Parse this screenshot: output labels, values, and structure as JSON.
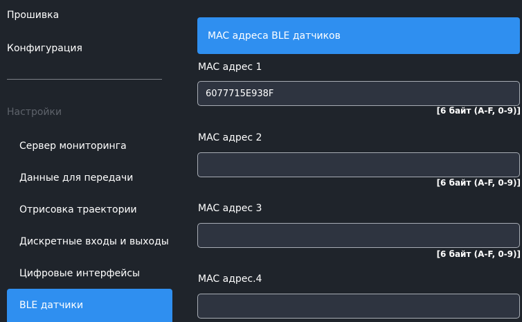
{
  "sidebar": {
    "top_links": [
      "Прошивка",
      "Конфигурация"
    ],
    "section_label": "Настройки",
    "items": [
      {
        "label": "Сервер мониторинга",
        "active": false
      },
      {
        "label": "Данные для передачи",
        "active": false
      },
      {
        "label": "Отрисовка траектории",
        "active": false
      },
      {
        "label": "Дискретные входы и выходы",
        "active": false
      },
      {
        "label": "Цифровые интерфейсы",
        "active": false
      },
      {
        "label": "BLE датчики",
        "active": true
      }
    ]
  },
  "main": {
    "banner_title": "MAC адреса BLE датчиков",
    "fields": [
      {
        "label": "MAC адрес 1",
        "value": "6077715E938F",
        "hint": "[6 байт (A-F, 0-9)]"
      },
      {
        "label": "MAC адрес 2",
        "value": "",
        "hint": "[6 байт (A-F, 0-9)]"
      },
      {
        "label": "MAC адрес 3",
        "value": "",
        "hint": "[6 байт (A-F, 0-9)]"
      },
      {
        "label": "MAC адрес.4",
        "value": "",
        "hint": ""
      }
    ]
  },
  "colors": {
    "background": "#1f242b",
    "accent": "#2f8ff0",
    "input_background": "#2e3440",
    "input_border": "#a8adb5",
    "muted_text": "#5e636b"
  }
}
